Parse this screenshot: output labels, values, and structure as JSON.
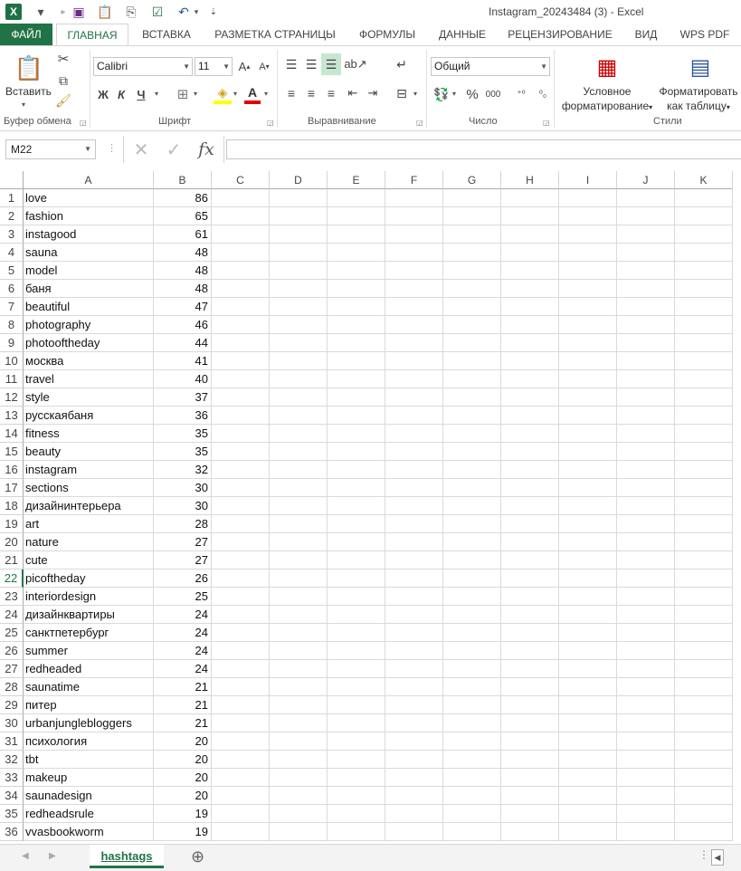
{
  "titlebar": {
    "title": "Instagram_20243484 (3) - Excel",
    "app_icon": "X"
  },
  "tabs": [
    {
      "label": "ФАЙЛ"
    },
    {
      "label": "ГЛАВНАЯ"
    },
    {
      "label": "ВСТАВКА"
    },
    {
      "label": "РАЗМЕТКА СТРАНИЦЫ"
    },
    {
      "label": "ФОРМУЛЫ"
    },
    {
      "label": "ДАННЫЕ"
    },
    {
      "label": "РЕЦЕНЗИРОВАНИЕ"
    },
    {
      "label": "ВИД"
    },
    {
      "label": "WPS PDF"
    }
  ],
  "ribbon": {
    "paste_label": "Вставить",
    "font_name": "Calibri",
    "font_size": "11",
    "bold": "Ж",
    "italic": "К",
    "underline": "Ч",
    "number_format": "Общий",
    "percent": "%",
    "thousands": "000",
    "cond_format_line1": "Условное",
    "cond_format_line2": "форматирование",
    "format_table_line1": "Форматировать",
    "format_table_line2": "как таблицу",
    "groups": {
      "clipboard": "Буфер обмена",
      "font": "Шрифт",
      "alignment": "Выравнивание",
      "number": "Число",
      "styles": "Стили"
    }
  },
  "formula_bar": {
    "name_box": "M22",
    "fx": "fx",
    "value": ""
  },
  "columns": [
    "A",
    "B",
    "C",
    "D",
    "E",
    "F",
    "G",
    "H",
    "I",
    "J",
    "K"
  ],
  "selected_row": 22,
  "rows": [
    {
      "n": "1",
      "a": "love",
      "b": "86"
    },
    {
      "n": "2",
      "a": "fashion",
      "b": "65"
    },
    {
      "n": "3",
      "a": "instagood",
      "b": "61"
    },
    {
      "n": "4",
      "a": "sauna",
      "b": "48"
    },
    {
      "n": "5",
      "a": "model",
      "b": "48"
    },
    {
      "n": "6",
      "a": "баня",
      "b": "48"
    },
    {
      "n": "7",
      "a": "beautiful",
      "b": "47"
    },
    {
      "n": "8",
      "a": "photography",
      "b": "46"
    },
    {
      "n": "9",
      "a": "photooftheday",
      "b": "44"
    },
    {
      "n": "10",
      "a": "москва",
      "b": "41"
    },
    {
      "n": "11",
      "a": "travel",
      "b": "40"
    },
    {
      "n": "12",
      "a": "style",
      "b": "37"
    },
    {
      "n": "13",
      "a": "русскаябаня",
      "b": "36"
    },
    {
      "n": "14",
      "a": "fitness",
      "b": "35"
    },
    {
      "n": "15",
      "a": "beauty",
      "b": "35"
    },
    {
      "n": "16",
      "a": "instagram",
      "b": "32"
    },
    {
      "n": "17",
      "a": "sections",
      "b": "30"
    },
    {
      "n": "18",
      "a": "дизайнинтерьера",
      "b": "30"
    },
    {
      "n": "19",
      "a": "art",
      "b": "28"
    },
    {
      "n": "20",
      "a": "nature",
      "b": "27"
    },
    {
      "n": "21",
      "a": "cute",
      "b": "27"
    },
    {
      "n": "22",
      "a": "picoftheday",
      "b": "26"
    },
    {
      "n": "23",
      "a": "interiordesign",
      "b": "25"
    },
    {
      "n": "24",
      "a": "дизайнквартиры",
      "b": "24"
    },
    {
      "n": "25",
      "a": "санктпетербург",
      "b": "24"
    },
    {
      "n": "26",
      "a": "summer",
      "b": "24"
    },
    {
      "n": "27",
      "a": "redheaded",
      "b": "24"
    },
    {
      "n": "28",
      "a": "saunatime",
      "b": "21"
    },
    {
      "n": "29",
      "a": "питер",
      "b": "21"
    },
    {
      "n": "30",
      "a": "urbanjunglebloggers",
      "b": "21"
    },
    {
      "n": "31",
      "a": "психология",
      "b": "20"
    },
    {
      "n": "32",
      "a": "tbt",
      "b": "20"
    },
    {
      "n": "33",
      "a": "makeup",
      "b": "20"
    },
    {
      "n": "34",
      "a": "saunadesign",
      "b": "20"
    },
    {
      "n": "35",
      "a": "redheadsrule",
      "b": "19"
    },
    {
      "n": "36",
      "a": "vvasbookworm",
      "b": "19"
    }
  ],
  "sheet": {
    "tab_label": "hashtags",
    "add_icon": "⊕"
  },
  "colors": {
    "accent": "#217346"
  }
}
